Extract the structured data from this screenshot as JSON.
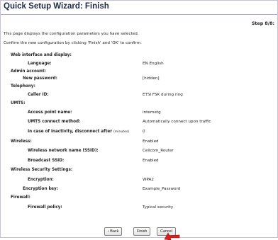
{
  "window": {
    "title": "Quick Setup Wizard: Finish",
    "step": "Step 8/8:"
  },
  "intro": {
    "line1": "This page displays the configuration parameters you have selected.",
    "line2": "Confirm the new configuration by clicking 'Finish' and 'OK' to confirm."
  },
  "sections": {
    "web": {
      "heading": "Web interface and display:",
      "language_label": "Language:",
      "language_value": "EN English"
    },
    "admin": {
      "heading": "Admin account:",
      "password_label": "New password:",
      "password_value": "[hidden]"
    },
    "telephony": {
      "heading": "Telephony:",
      "callerid_label": "Caller ID:",
      "callerid_value": "ETSI FSK during ring"
    },
    "umts": {
      "heading": "UMTS:",
      "apn_label": "Access point name:",
      "apn_value": "internetg",
      "method_label": "UMTS connect method:",
      "method_value": "Automatically connect upon traffic",
      "inactivity_label": "In case of inactivity, disconnect after",
      "inactivity_unit": "(minutes)",
      "inactivity_value": "0"
    },
    "wireless": {
      "heading": "Wireless:",
      "heading_value": "Enabled",
      "ssid_label": "Wireless network name (SSID):",
      "ssid_value": "Cellcom_Router",
      "broadcast_label": "Broadcast SSID:",
      "broadcast_value": "Enabled"
    },
    "security": {
      "heading": "Wireless Security Settings:",
      "encryption_label": "Encryption:",
      "encryption_value": "WPA2",
      "key_label": "Encryption key:",
      "key_value": "Example_Password"
    },
    "firewall": {
      "heading": "Firewall:",
      "policy_label": "Firewall policy:",
      "policy_value": "Typical security"
    }
  },
  "buttons": {
    "back": "‹ Back",
    "finish": "Finish",
    "cancel": "Cancel"
  },
  "colors": {
    "title": "#1f2a44",
    "title_border": "#b9a9d3",
    "cursor": "#e0201c"
  }
}
